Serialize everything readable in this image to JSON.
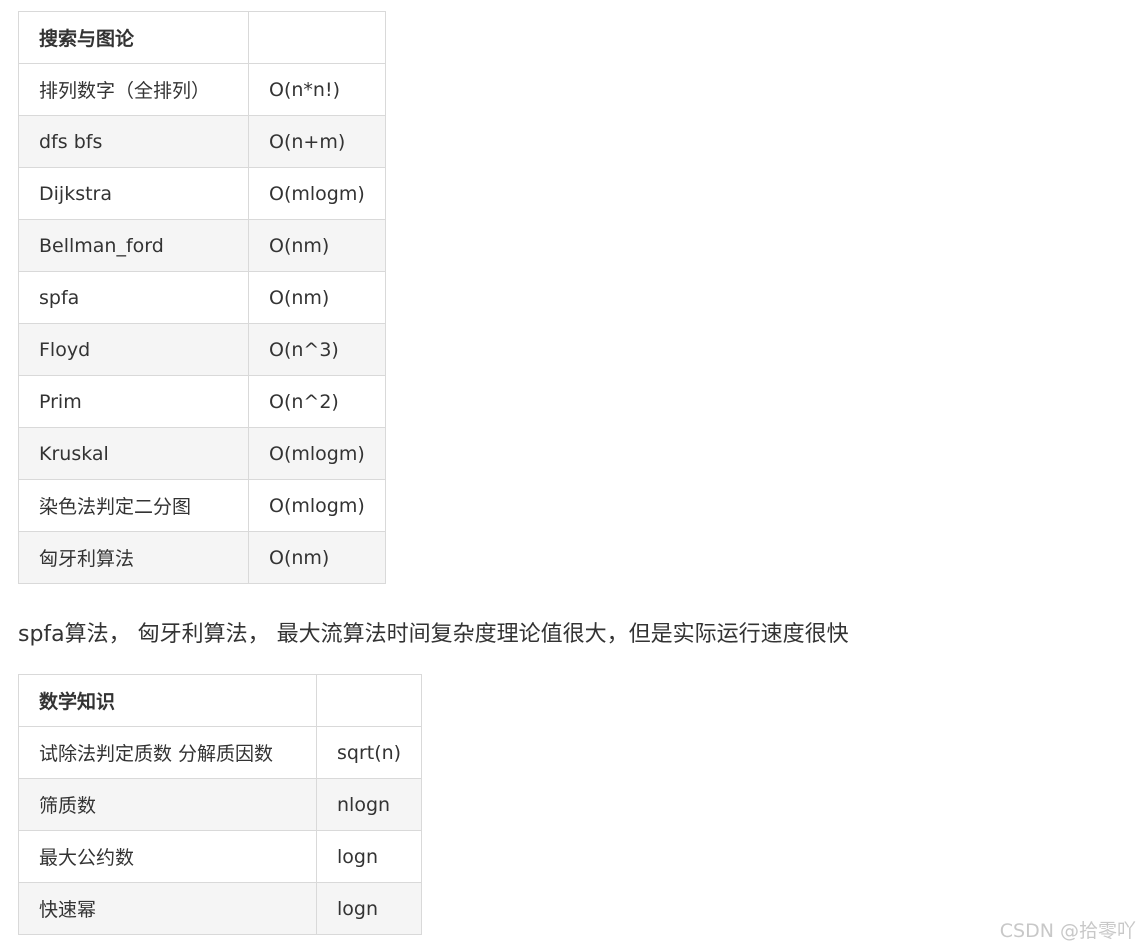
{
  "search_graph_table": {
    "header": [
      "搜索与图论",
      ""
    ],
    "rows": [
      [
        "排列数字（全排列）",
        "O(n*n!)"
      ],
      [
        "dfs bfs",
        "O(n+m)"
      ],
      [
        "Dijkstra",
        "O(mlogm)"
      ],
      [
        "Bellman_ford",
        "O(nm)"
      ],
      [
        "spfa",
        "O(nm)"
      ],
      [
        "Floyd",
        "O(n^3)"
      ],
      [
        "Prim",
        "O(n^2)"
      ],
      [
        "Kruskal",
        "O(mlogm)"
      ],
      [
        "染色法判定二分图",
        "O(mlogm)"
      ],
      [
        "匈牙利算法",
        "O(nm)"
      ]
    ]
  },
  "note": "spfa算法， 匈牙利算法， 最大流算法时间复杂度理论值很大，但是实际运行速度很快",
  "math_table": {
    "header": [
      "数学知识",
      ""
    ],
    "rows": [
      [
        "试除法判定质数 分解质因数",
        "sqrt(n)"
      ],
      [
        "筛质数",
        "nlogn"
      ],
      [
        "最大公约数",
        "logn"
      ],
      [
        "快速幂",
        "logn"
      ]
    ]
  },
  "watermark": "CSDN @拾零吖"
}
